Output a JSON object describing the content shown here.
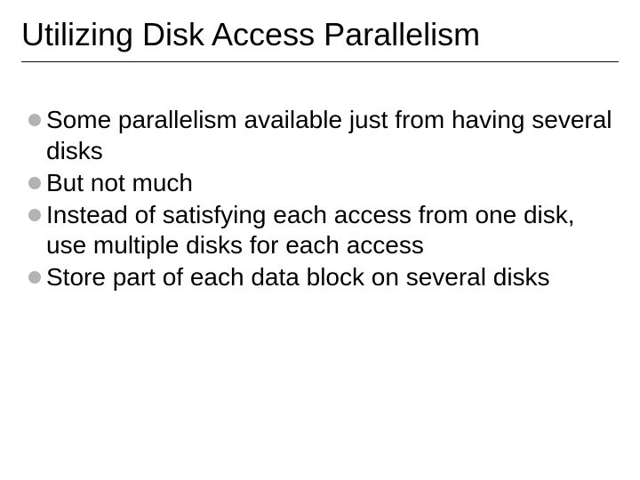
{
  "slide": {
    "title": "Utilizing Disk Access Parallelism",
    "bullets": [
      "Some parallelism available just from having several disks",
      "But not much",
      "Instead of satisfying each access from one disk, use multiple disks for each access",
      "Store part of each data block on several disks"
    ]
  }
}
